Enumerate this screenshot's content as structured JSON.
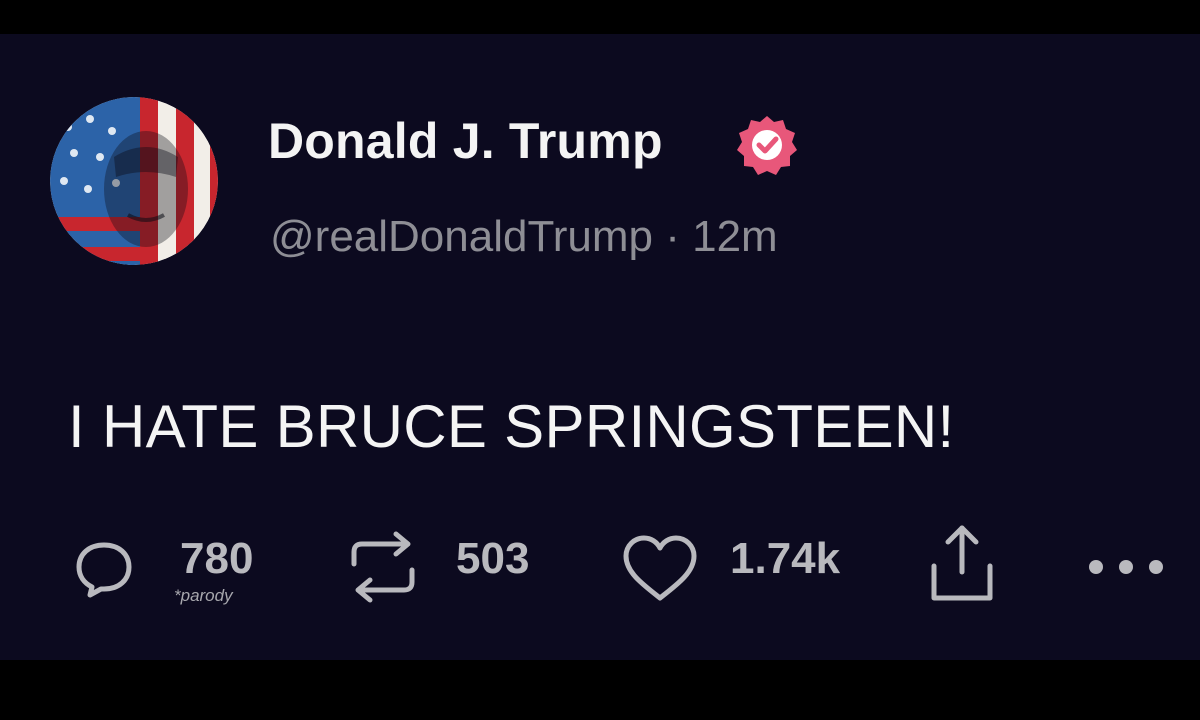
{
  "post": {
    "author": {
      "display_name": "Donald J. Trump",
      "handle": "@realDonaldTrump",
      "separator": "·",
      "time_ago": "12m",
      "verified": true,
      "avatar_icon": "flag-painted-portrait"
    },
    "text": "I HATE BRUCE SPRINGSTEEN!",
    "actions": {
      "replies": {
        "icon": "comment-icon",
        "count": "780",
        "note": "*parody"
      },
      "reposts": {
        "icon": "repost-icon",
        "count": "503"
      },
      "likes": {
        "icon": "heart-icon",
        "count": "1.74k"
      },
      "share": {
        "icon": "share-icon"
      },
      "more": {
        "icon": "more-icon"
      }
    }
  },
  "colors": {
    "background": "#0c0a1f",
    "primary_text": "#f4f4f4",
    "secondary_text": "#8e8e95",
    "action_gray": "#b9b9be",
    "verified_badge": "#e8577a"
  }
}
